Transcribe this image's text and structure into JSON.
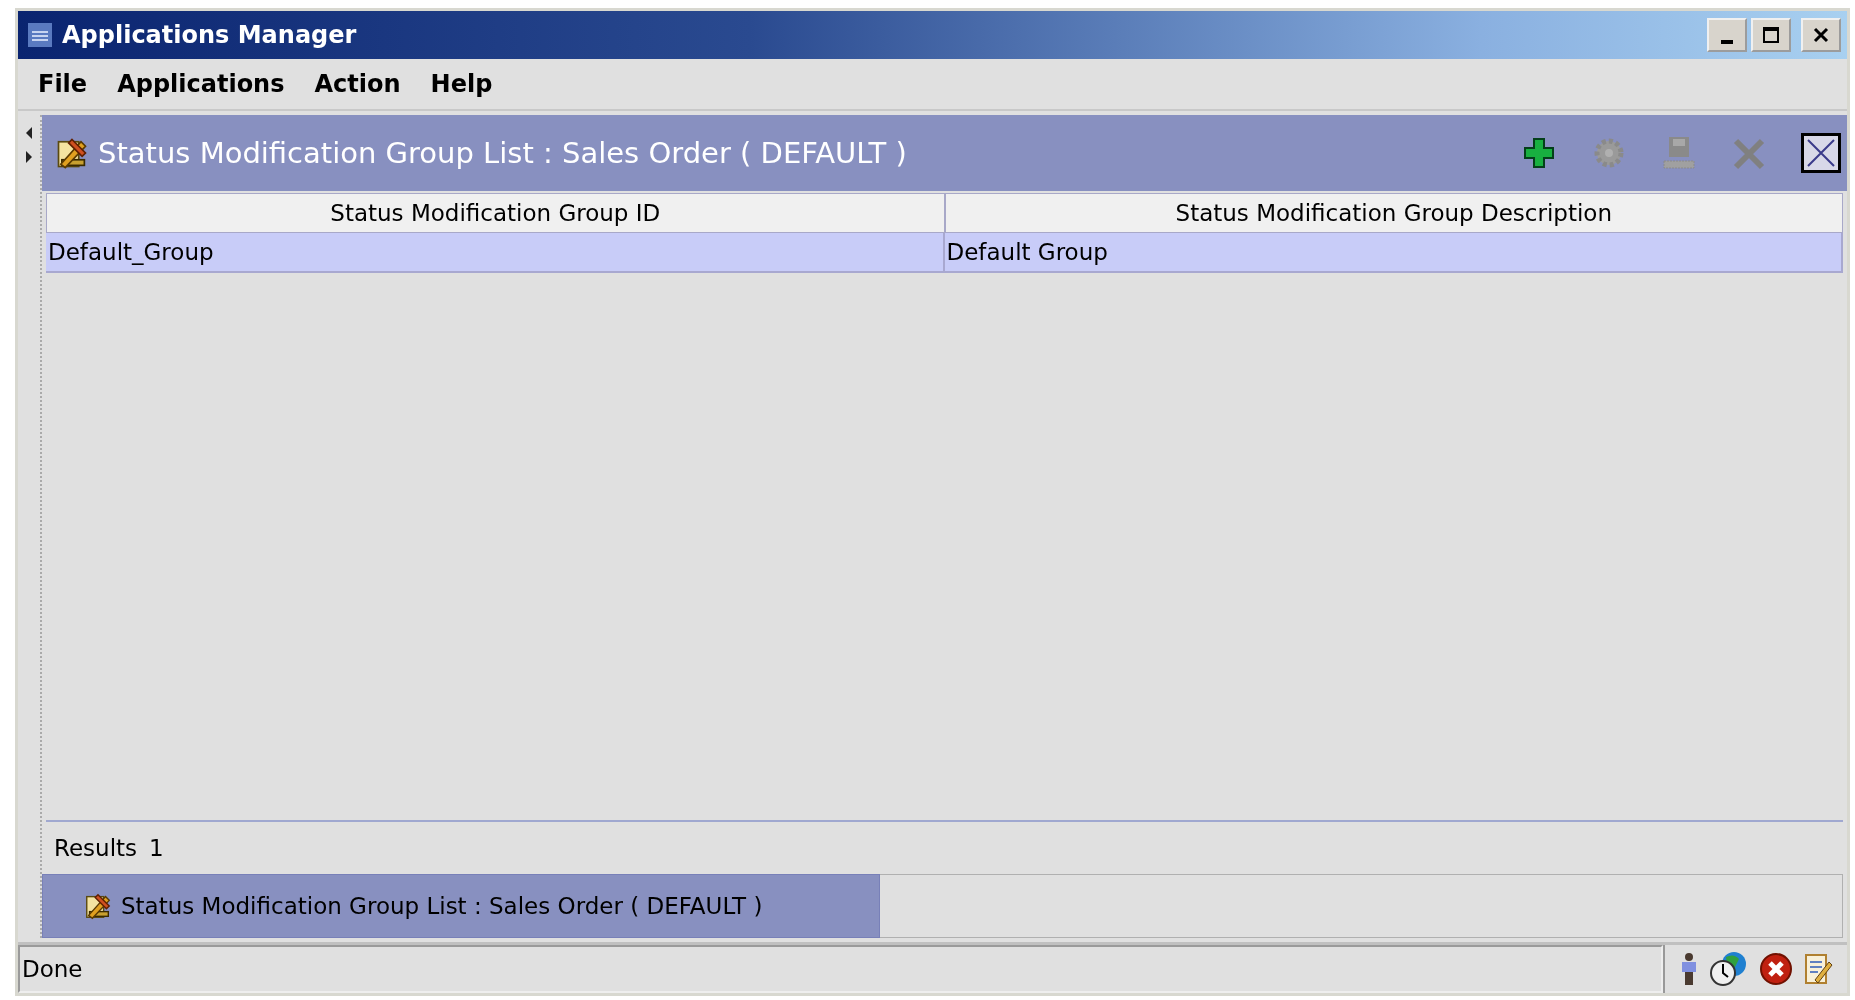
{
  "window": {
    "title": "Applications Manager"
  },
  "menu": [
    {
      "label": "File"
    },
    {
      "label": "Applications"
    },
    {
      "label": "Action"
    },
    {
      "label": "Help"
    }
  ],
  "frame": {
    "title": "Status Modification Group List : Sales Order ( DEFAULT )",
    "toolbar": [
      {
        "kind": "add",
        "disabled": false
      },
      {
        "kind": "details",
        "disabled": true
      },
      {
        "kind": "save",
        "disabled": true
      },
      {
        "kind": "delete",
        "disabled": true
      },
      {
        "kind": "close",
        "disabled": false
      }
    ]
  },
  "table": {
    "columns": [
      "Status Modification Group ID",
      "Status Modification Group Description"
    ],
    "rows": [
      {
        "cells": [
          "Default_Group",
          "Default Group"
        ],
        "selected": true
      }
    ]
  },
  "results": {
    "label": "Results",
    "count": "1"
  },
  "window_tabs": [
    {
      "label": "Status Modification Group List : Sales Order ( DEFAULT )",
      "selected": true
    }
  ],
  "status_bar": {
    "text": "Done"
  }
}
